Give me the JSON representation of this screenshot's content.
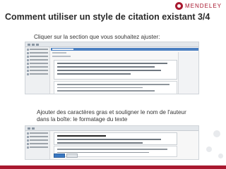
{
  "brand": {
    "name": "MENDELEY",
    "color": "#a8182f"
  },
  "slide": {
    "title": "Comment utiliser un style de citation existant 3/4",
    "caption_top": "Cliquer sur la section que vous souhaitez ajuster:",
    "caption_bottom_line1": "Ajouter des caractères gras et souligner le nom de l'auteur",
    "caption_bottom_line2": "dans la boîte: le formatage du texte"
  },
  "screens": [
    {
      "name": "citation-editor-before",
      "bold_author": false
    },
    {
      "name": "citation-editor-after",
      "bold_author": true
    }
  ]
}
